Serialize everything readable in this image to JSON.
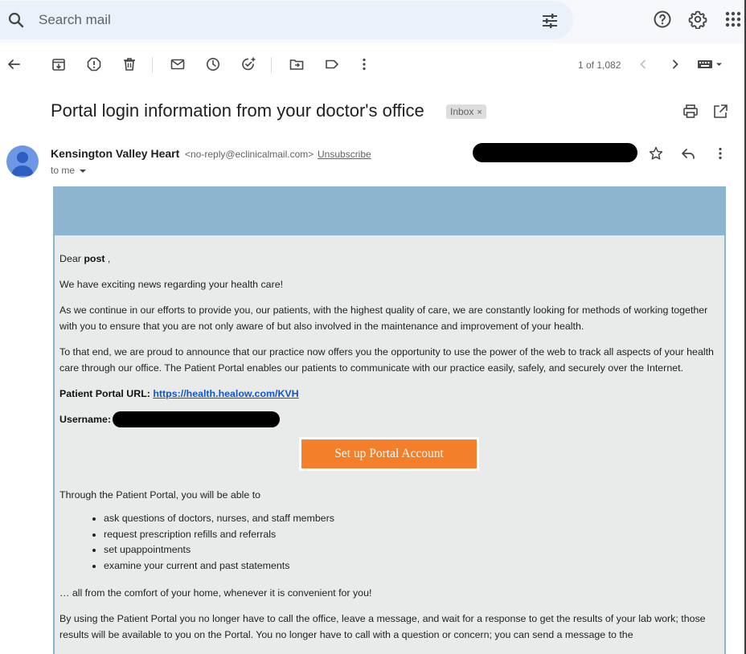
{
  "search": {
    "placeholder": "Search mail"
  },
  "toolbar": {
    "pagination": "1 of 1,082"
  },
  "email": {
    "subject": "Portal login information from your doctor's office",
    "label_chip": "Inbox",
    "label_chip_close": "×",
    "sender_name": "Kensington Valley Heart",
    "sender_email": "<no-reply@eclinicalmail.com>",
    "unsubscribe": "Unsubscribe",
    "recipient": "to me",
    "body": {
      "greeting_prefix": "Dear ",
      "greeting_name": "post",
      "greeting_suffix": " ,",
      "p1": "We have exciting news regarding your health care!",
      "p2": "As we continue in our efforts to provide you, our patients, with the highest quality of care, we are constantly looking for methods of working together with you to ensure that you are not only aware of but also involved in the maintenance and improvement of your health.",
      "p3": "To that end, we are proud to announce that our practice now offers you the opportunity to use the power of the web to track all aspects of your health care through our office.  The Patient Portal enables our patients to communicate with our practice easily, safely, and securely over the Internet.",
      "portal_url_label": "Patient Portal URL: ",
      "portal_url": "https://health.healow.com/KVH",
      "username_label": "Username:",
      "cta_button": "Set up Portal Account",
      "list_intro": "Through the Patient Portal, you will be able to",
      "list_items": [
        "ask questions of doctors, nurses, and staff members",
        "request prescription refills and referrals",
        "set upappointments",
        "examine your current and past statements"
      ],
      "p_comfort": "… all from the comfort of your home, whenever it is convenient for you!",
      "p_last": "By using the Patient Portal you no longer have to call the office, leave a message, and wait for a response to get the results of your lab work; those results will be available to you on the Portal.  You no longer have to call with a question or concern; you can send a message to the"
    }
  },
  "colors": {
    "accent_button": "#f47f2a",
    "email_header": "#8db5d0",
    "email_background": "#e9ebeb",
    "link": "#1155cc",
    "avatar": "#6e98e4"
  },
  "icons": [
    "search-icon",
    "tune-icon",
    "help-icon",
    "settings-icon",
    "apps-icon",
    "back-arrow-icon",
    "archive-icon",
    "report-spam-icon",
    "delete-icon",
    "mark-unread-icon",
    "snooze-icon",
    "add-task-icon",
    "move-to-icon",
    "label-icon",
    "more-vert-icon",
    "prev-icon",
    "next-icon",
    "keyboard-icon",
    "print-icon",
    "open-new-window-icon",
    "star-icon",
    "reply-icon",
    "avatar-person-icon"
  ]
}
